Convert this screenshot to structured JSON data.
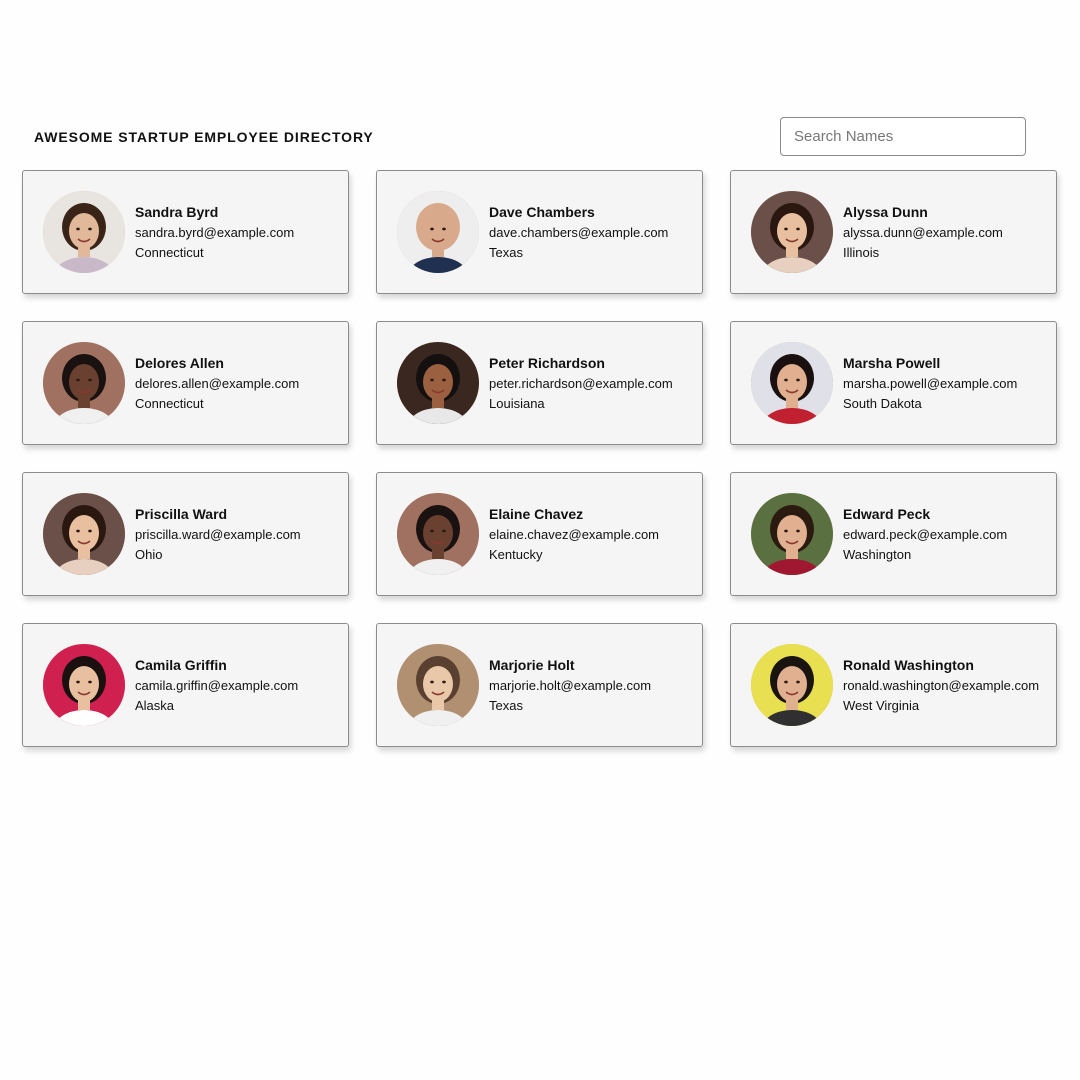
{
  "header": {
    "title": "AWESOME STARTUP EMPLOYEE DIRECTORY",
    "search_placeholder": "Search Names"
  },
  "employees": [
    {
      "name": "Sandra Byrd",
      "email": "sandra.byrd@example.com",
      "state": "Connecticut",
      "bg": "#e8e4e0",
      "skin": "#e2b89a",
      "hair": "#3a2418",
      "shirt": "#c8b8c8"
    },
    {
      "name": "Dave Chambers",
      "email": "dave.chambers@example.com",
      "state": "Texas",
      "bg": "#eeeeee",
      "skin": "#d9a98c",
      "hair": "#d9a98c",
      "shirt": "#1f3050"
    },
    {
      "name": "Alyssa Dunn",
      "email": "alyssa.dunn@example.com",
      "state": "Illinois",
      "bg": "#6a5048",
      "skin": "#e8c0a0",
      "hair": "#2a1810",
      "shirt": "#e8d0c0"
    },
    {
      "name": "Delores Allen",
      "email": "delores.allen@example.com",
      "state": "Connecticut",
      "bg": "#a07060",
      "skin": "#6a4030",
      "hair": "#1a1210",
      "shirt": "#f0f0f0"
    },
    {
      "name": "Peter Richardson",
      "email": "peter.richardson@example.com",
      "state": "Louisiana",
      "bg": "#3a2820",
      "skin": "#9a6040",
      "hair": "#141010",
      "shirt": "#e8e8e8"
    },
    {
      "name": "Marsha Powell",
      "email": "marsha.powell@example.com",
      "state": "South Dakota",
      "bg": "#e0e0e8",
      "skin": "#e0b090",
      "hair": "#1a1010",
      "shirt": "#c02030"
    },
    {
      "name": "Priscilla Ward",
      "email": "priscilla.ward@example.com",
      "state": "Ohio",
      "bg": "#6a5048",
      "skin": "#e8c0a0",
      "hair": "#2a1810",
      "shirt": "#e8d0c0"
    },
    {
      "name": "Elaine Chavez",
      "email": "elaine.chavez@example.com",
      "state": "Kentucky",
      "bg": "#a07060",
      "skin": "#6a4030",
      "hair": "#1a1210",
      "shirt": "#f0f0f0"
    },
    {
      "name": "Edward Peck",
      "email": "edward.peck@example.com",
      "state": "Washington",
      "bg": "#5a7040",
      "skin": "#e0b090",
      "hair": "#2a1a10",
      "shirt": "#a01830"
    },
    {
      "name": "Camila Griffin",
      "email": "camila.griffin@example.com",
      "state": "Alaska",
      "bg": "#d02050",
      "skin": "#e8c0a0",
      "hair": "#1a1010",
      "shirt": "#ffffff"
    },
    {
      "name": "Marjorie Holt",
      "email": "marjorie.holt@example.com",
      "state": "Texas",
      "bg": "#b09070",
      "skin": "#e8c8a8",
      "hair": "#5a4030",
      "shirt": "#f0f0f0"
    },
    {
      "name": "Ronald Washington",
      "email": "ronald.washington@example.com",
      "state": "West Virginia",
      "bg": "#e8e050",
      "skin": "#e0b090",
      "hair": "#1a1410",
      "shirt": "#303030"
    }
  ]
}
